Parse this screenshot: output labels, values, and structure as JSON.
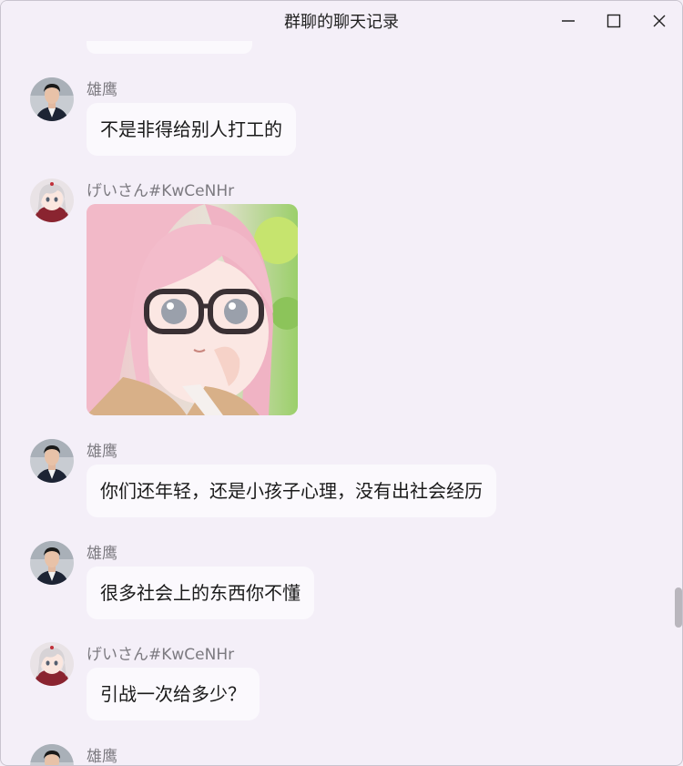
{
  "window": {
    "title": "群聊的聊天记录",
    "controls": [
      "minimize-icon",
      "maximize-icon",
      "close-icon"
    ]
  },
  "messages": [
    {
      "sender": "雄鹰",
      "avatar": "man-portrait-avatar",
      "type": "text",
      "text": "不是非得给别人打工的"
    },
    {
      "sender": "げいさん#KwCeNHr",
      "avatar": "anime-girl-avatar",
      "type": "image",
      "image": "anime-girl-pink-hair-glasses"
    },
    {
      "sender": "雄鹰",
      "avatar": "man-portrait-avatar",
      "type": "text",
      "text": "你们还年轻，还是小孩子心理，没有出社会经历"
    },
    {
      "sender": "雄鹰",
      "avatar": "man-portrait-avatar",
      "type": "text",
      "text": "很多社会上的东西你不懂"
    },
    {
      "sender": "げいさん#KwCeNHr",
      "avatar": "anime-girl-avatar",
      "type": "text",
      "text": "引战一次给多少？"
    },
    {
      "sender": "雄鹰",
      "avatar": "man-portrait-avatar",
      "type": "text",
      "text": ""
    }
  ],
  "colors": {
    "background": "#f4eff8",
    "bubble": "#fbf9fd",
    "sender_text": "#7c7a80"
  }
}
